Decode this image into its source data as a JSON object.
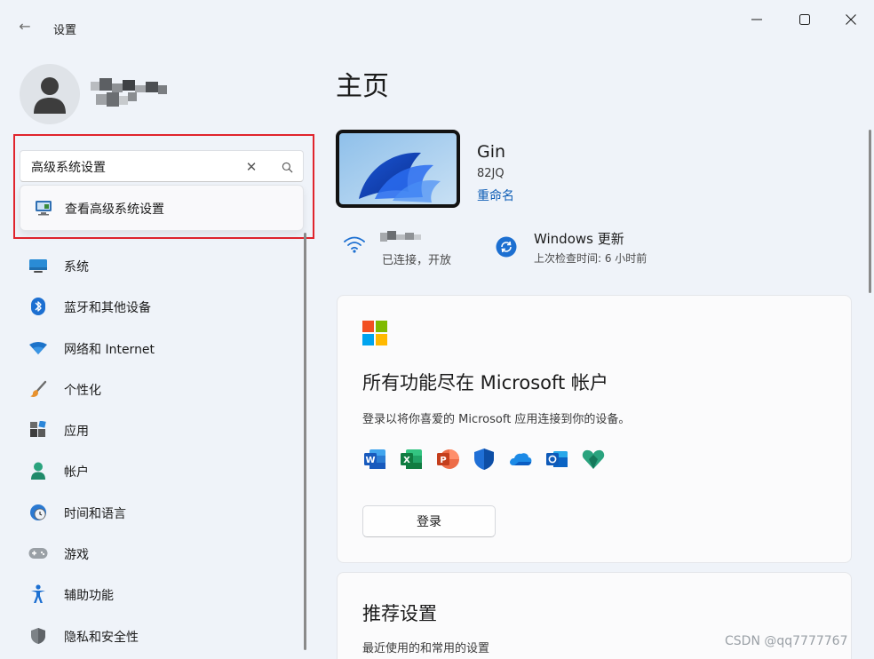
{
  "window": {
    "title": "设置",
    "controls": {
      "minimize": "—",
      "maximize": "☐",
      "close": "✕"
    }
  },
  "sidebar": {
    "search": {
      "value": "高级系统设置",
      "suggestion": "查看高级系统设置"
    },
    "items": [
      {
        "label": "系统",
        "icon": "monitor-icon"
      },
      {
        "label": "蓝牙和其他设备",
        "icon": "bluetooth-icon"
      },
      {
        "label": "网络和 Internet",
        "icon": "wifi-diamond-icon"
      },
      {
        "label": "个性化",
        "icon": "brush-icon"
      },
      {
        "label": "应用",
        "icon": "apps-icon"
      },
      {
        "label": "帐户",
        "icon": "person-icon"
      },
      {
        "label": "时间和语言",
        "icon": "globe-clock-icon"
      },
      {
        "label": "游戏",
        "icon": "gamepad-icon"
      },
      {
        "label": "辅助功能",
        "icon": "accessibility-icon"
      },
      {
        "label": "隐私和安全性",
        "icon": "shield-icon"
      }
    ]
  },
  "main": {
    "title": "主页",
    "device": {
      "name": "Gin",
      "model": "82JQ",
      "rename": "重命名"
    },
    "network": {
      "status": "已连接，开放"
    },
    "update": {
      "title": "Windows 更新",
      "subtitle": "上次检查时间: 6 小时前"
    },
    "ms_card": {
      "title": "所有功能尽在 Microsoft 帐户",
      "description": "登录以将你喜爱的 Microsoft 应用连接到你的设备。",
      "apps": [
        "word-icon",
        "excel-icon",
        "powerpoint-icon",
        "defender-icon",
        "onedrive-icon",
        "outlook-icon",
        "family-icon"
      ],
      "login_label": "登录"
    },
    "recommended": {
      "title": "推荐设置",
      "subtitle": "最近使用的和常用的设置"
    }
  },
  "watermark": "CSDN @qq7777767",
  "colors": {
    "accent": "#0f5eb6",
    "highlight": "#e0242d",
    "background": "#eff3f9"
  }
}
